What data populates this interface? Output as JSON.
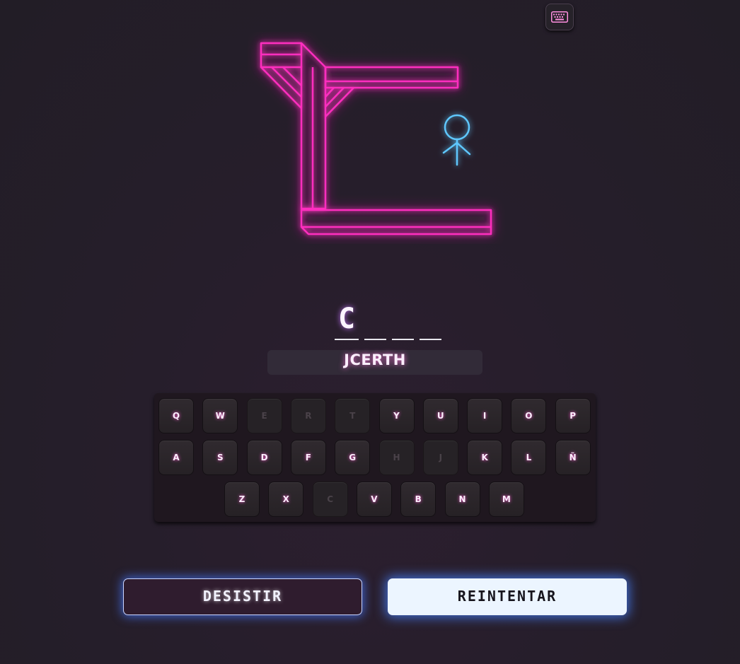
{
  "game": {
    "word_slots": [
      "C",
      "",
      "",
      ""
    ],
    "guessed_letters": "JCERTH"
  },
  "keyboard": {
    "rows": [
      [
        {
          "key": "Q",
          "used": false
        },
        {
          "key": "W",
          "used": false
        },
        {
          "key": "E",
          "used": true
        },
        {
          "key": "R",
          "used": true
        },
        {
          "key": "T",
          "used": true
        },
        {
          "key": "Y",
          "used": false
        },
        {
          "key": "U",
          "used": false
        },
        {
          "key": "I",
          "used": false
        },
        {
          "key": "O",
          "used": false
        },
        {
          "key": "P",
          "used": false
        }
      ],
      [
        {
          "key": "A",
          "used": false
        },
        {
          "key": "S",
          "used": false
        },
        {
          "key": "D",
          "used": false
        },
        {
          "key": "F",
          "used": false
        },
        {
          "key": "G",
          "used": false
        },
        {
          "key": "H",
          "used": true
        },
        {
          "key": "J",
          "used": true
        },
        {
          "key": "K",
          "used": false
        },
        {
          "key": "L",
          "used": false
        },
        {
          "key": "Ñ",
          "used": false
        }
      ],
      [
        {
          "key": "Z",
          "used": false
        },
        {
          "key": "X",
          "used": false
        },
        {
          "key": "C",
          "used": true
        },
        {
          "key": "V",
          "used": false
        },
        {
          "key": "B",
          "used": false
        },
        {
          "key": "N",
          "used": false
        },
        {
          "key": "M",
          "used": false
        }
      ]
    ]
  },
  "actions": {
    "quit_label": "DESISTIR",
    "retry_label": "REINTENTAR"
  },
  "icons": {
    "keyboard_toggle": "keyboard-icon"
  },
  "colors": {
    "gallows_neon": "#ff2fbf",
    "figure_neon": "#5ec8ff",
    "rope": "#e7e07a",
    "button_glow": "#4678ff"
  }
}
